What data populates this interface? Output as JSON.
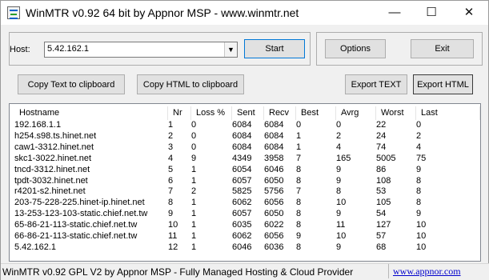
{
  "window": {
    "title": "WinMTR v0.92 64 bit by Appnor MSP - www.winmtr.net",
    "minimize_glyph": "—",
    "maximize_glyph": "☐",
    "close_glyph": "✕"
  },
  "host": {
    "label": "Host:",
    "value": "5.42.162.1",
    "dropdown_glyph": "▼"
  },
  "buttons": {
    "start": "Start",
    "options": "Options",
    "exit": "Exit",
    "copy_text": "Copy Text to clipboard",
    "copy_html": "Copy HTML to clipboard",
    "export_text": "Export TEXT",
    "export_html": "Export HTML"
  },
  "table": {
    "headers": [
      "Hostname",
      "Nr",
      "Loss %",
      "Sent",
      "Recv",
      "Best",
      "Avrg",
      "Worst",
      "Last"
    ],
    "rows": [
      [
        "192.168.1.1",
        "1",
        "0",
        "6084",
        "6084",
        "0",
        "0",
        "22",
        "0"
      ],
      [
        "h254.s98.ts.hinet.net",
        "2",
        "0",
        "6084",
        "6084",
        "1",
        "2",
        "24",
        "2"
      ],
      [
        "caw1-3312.hinet.net",
        "3",
        "0",
        "6084",
        "6084",
        "1",
        "4",
        "74",
        "4"
      ],
      [
        "skc1-3022.hinet.net",
        "4",
        "9",
        "4349",
        "3958",
        "7",
        "165",
        "5005",
        "75"
      ],
      [
        "tncd-3312.hinet.net",
        "5",
        "1",
        "6054",
        "6046",
        "8",
        "9",
        "86",
        "9"
      ],
      [
        "tpdt-3032.hinet.net",
        "6",
        "1",
        "6057",
        "6050",
        "8",
        "9",
        "108",
        "8"
      ],
      [
        "r4201-s2.hinet.net",
        "7",
        "2",
        "5825",
        "5756",
        "7",
        "8",
        "53",
        "8"
      ],
      [
        "203-75-228-225.hinet-ip.hinet.net",
        "8",
        "1",
        "6062",
        "6056",
        "8",
        "10",
        "105",
        "8"
      ],
      [
        "13-253-123-103-static.chief.net.tw",
        "9",
        "1",
        "6057",
        "6050",
        "8",
        "9",
        "54",
        "9"
      ],
      [
        "65-86-21-113-static.chief.net.tw",
        "10",
        "1",
        "6035",
        "6022",
        "8",
        "11",
        "127",
        "10"
      ],
      [
        "66-86-21-113-static.chief.net.tw",
        "11",
        "1",
        "6062",
        "6056",
        "9",
        "10",
        "57",
        "10"
      ],
      [
        "5.42.162.1",
        "12",
        "1",
        "6046",
        "6036",
        "8",
        "9",
        "68",
        "10"
      ]
    ]
  },
  "status": {
    "text": "WinMTR v0.92 GPL V2 by Appnor MSP - Fully Managed Hosting & Cloud Provider",
    "link": "www.appnor.com"
  }
}
